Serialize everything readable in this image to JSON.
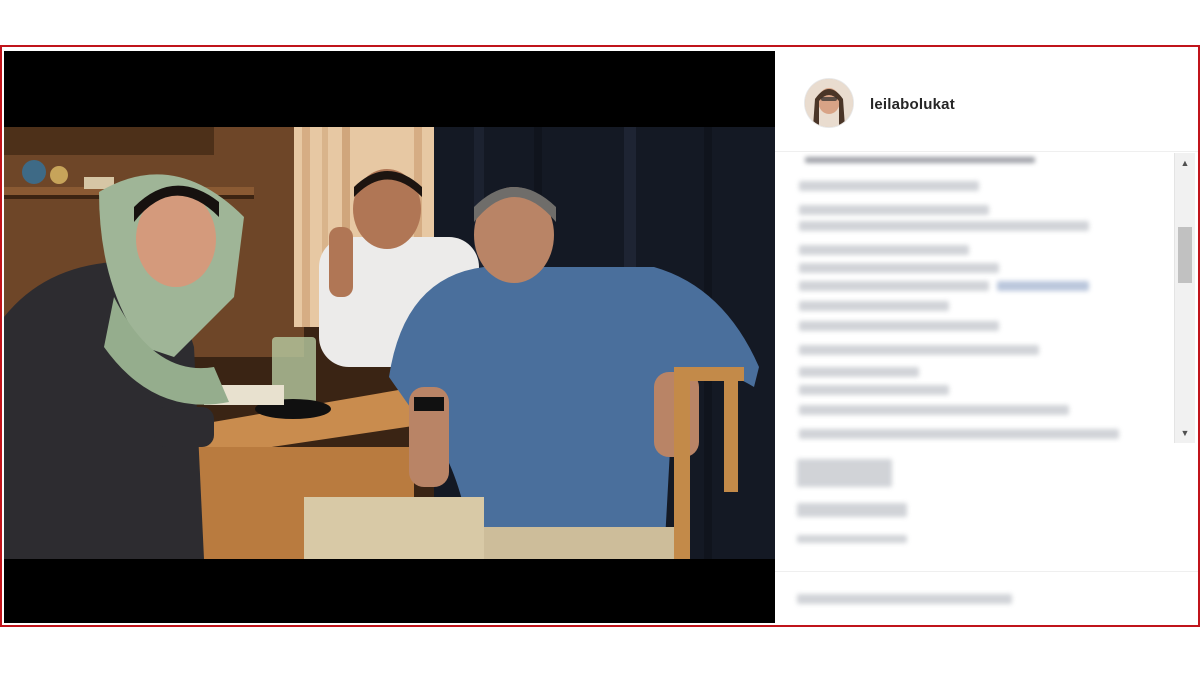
{
  "post": {
    "username": "leilabolukat",
    "avatar_icon": "profile-avatar-icon",
    "photo_icon": "post-photo-image"
  },
  "colors": {
    "frame_border": "#c0141b",
    "letterbox": "#000000",
    "scrollbar_track": "#f1f1f1",
    "scrollbar_thumb": "#c1c1c1"
  },
  "scrollbar": {
    "up_arrow": "▲",
    "down_arrow": "▼"
  }
}
